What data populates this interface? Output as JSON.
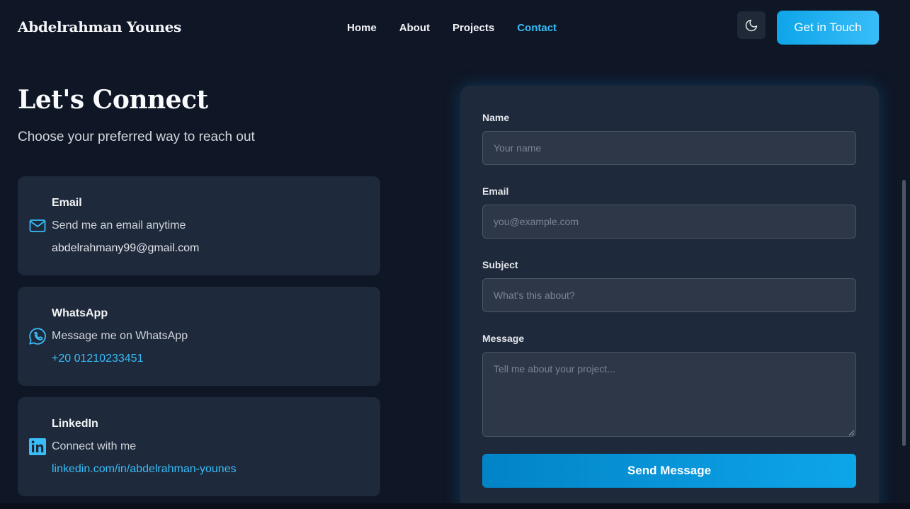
{
  "header": {
    "logo": "Abdelrahman Younes",
    "nav": [
      {
        "label": "Home",
        "active": false
      },
      {
        "label": "About",
        "active": false
      },
      {
        "label": "Projects",
        "active": false
      },
      {
        "label": "Contact",
        "active": true
      }
    ],
    "theme_toggle_icon": "moon-icon",
    "cta_label": "Get in Touch"
  },
  "contact": {
    "title": "Let's Connect",
    "subtitle": "Choose your preferred way to reach out",
    "cards": [
      {
        "icon": "mail-icon",
        "title": "Email",
        "description": "Send me an email anytime",
        "value": "abdelrahmany99@gmail.com"
      },
      {
        "icon": "whatsapp-icon",
        "title": "WhatsApp",
        "description": "Message me on WhatsApp",
        "value": "+20 01210233451"
      },
      {
        "icon": "linkedin-icon",
        "title": "LinkedIn",
        "description": "Connect with me",
        "value": "linkedin.com/in/abdelrahman-younes"
      }
    ]
  },
  "form": {
    "name_label": "Name",
    "name_placeholder": "Your name",
    "name_value": "",
    "email_label": "Email",
    "email_placeholder": "you@example.com",
    "email_value": "",
    "subject_label": "Subject",
    "subject_placeholder": "What's this about?",
    "subject_value": "",
    "message_label": "Message",
    "message_placeholder": "Tell me about your project...",
    "message_value": "",
    "submit_label": "Send Message"
  },
  "colors": {
    "background": "#0f1626",
    "card": "#1e293b",
    "accent": "#38bdf8",
    "button": "#0ea5e9"
  }
}
